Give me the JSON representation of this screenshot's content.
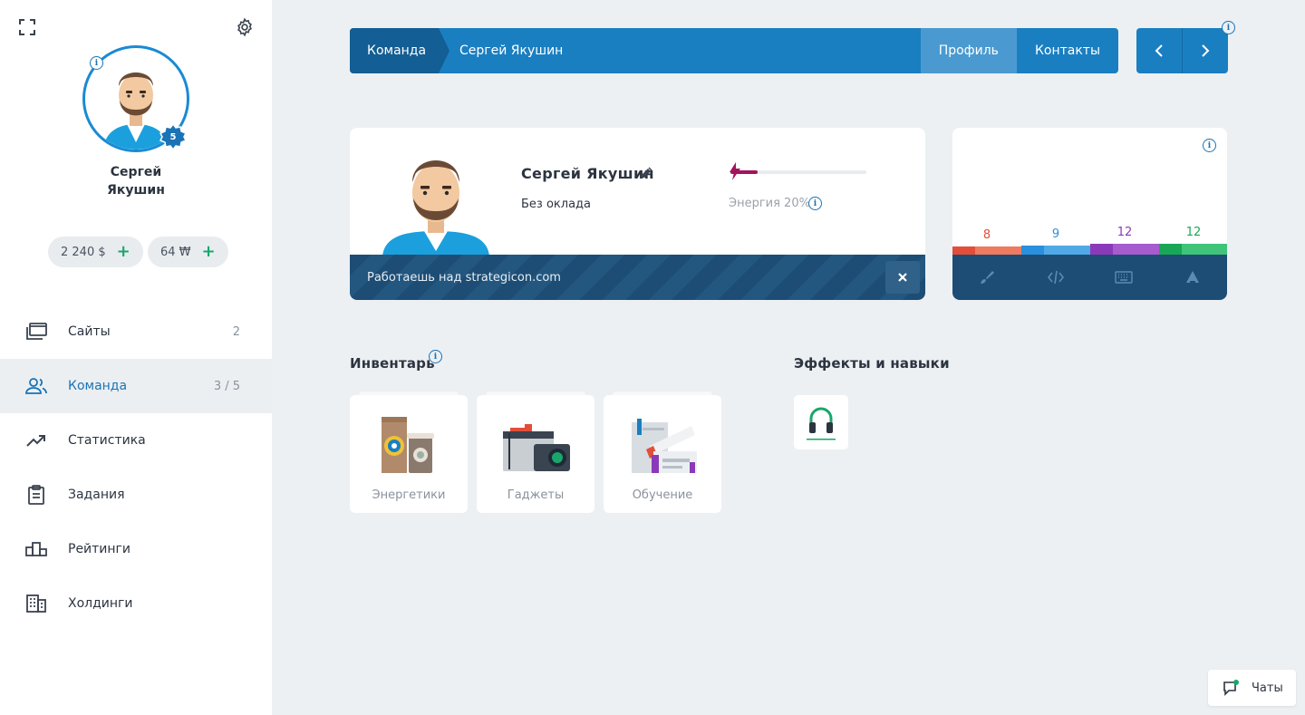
{
  "sidebar": {
    "user_name_line1": "Сергей",
    "user_name_line2": "Якушин",
    "level": "5",
    "balance_money": "2 240 $",
    "balance_points": "64 ₩",
    "items": [
      {
        "label": "Сайты",
        "count": "2",
        "icon": "browser-windows-icon"
      },
      {
        "label": "Команда",
        "count": "3 / 5",
        "icon": "team-icon",
        "active": true
      },
      {
        "label": "Статистика",
        "count": "",
        "icon": "trend-icon"
      },
      {
        "label": "Задания",
        "count": "",
        "icon": "clipboard-icon"
      },
      {
        "label": "Рейтинги",
        "count": "",
        "icon": "podium-icon"
      },
      {
        "label": "Холдинги",
        "count": "",
        "icon": "buildings-icon"
      }
    ]
  },
  "topbar": {
    "crumb_first": "Команда",
    "crumb_second": "Сергей Якушин",
    "tabs": [
      {
        "label": "Профиль",
        "active": true
      },
      {
        "label": "Контакты",
        "active": false
      }
    ]
  },
  "profile": {
    "name": "Сергей Якушин",
    "salary": "Без оклада",
    "energy_label": "Энергия 20%",
    "energy_percent": 20,
    "work_text": "Работаешь над strategicon.com"
  },
  "skills": [
    {
      "value": "8",
      "color": "#e24e3a",
      "color2": "#ee7a5f",
      "icon": "brush-icon"
    },
    {
      "value": "9",
      "color": "#2a8fdc",
      "color2": "#4fa9e6",
      "icon": "code-icon"
    },
    {
      "value": "12",
      "color": "#8a3ab9",
      "color2": "#a65bce",
      "icon": "keyboard-icon"
    },
    {
      "value": "12",
      "color": "#19a655",
      "color2": "#3fc47a",
      "icon": "megaphone-icon"
    }
  ],
  "inventory": {
    "title": "Инвентарь",
    "items": [
      {
        "label": "Энергетики"
      },
      {
        "label": "Гаджеты"
      },
      {
        "label": "Обучение"
      }
    ]
  },
  "effects": {
    "title": "Эффекты и навыки"
  },
  "chat": {
    "label": "Чаты"
  }
}
